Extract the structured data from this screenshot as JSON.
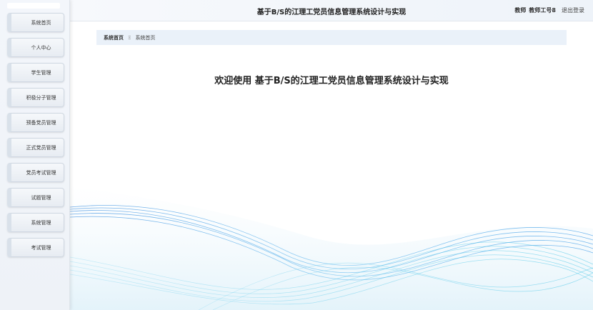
{
  "header": {
    "title": "基于B/S的江理工党员信息管理系统设计与实现",
    "role": "教师",
    "user": "教师工号8",
    "logout": "退出登录"
  },
  "sidebar": {
    "items": [
      {
        "label": "系统首页"
      },
      {
        "label": "个人中心"
      },
      {
        "label": "学生管理"
      },
      {
        "label": "积极分子管理"
      },
      {
        "label": "预备党员管理"
      },
      {
        "label": "正式党员管理"
      },
      {
        "label": "党员考试管理"
      },
      {
        "label": "试题管理"
      },
      {
        "label": "系统管理"
      },
      {
        "label": "考试管理"
      }
    ]
  },
  "breadcrumb": {
    "home": "系统首页",
    "separator": "Ξ",
    "current": "系统首页"
  },
  "main": {
    "welcome": "欢迎使用 基于B/S的江理工党员信息管理系统设计与实现"
  },
  "colors": {
    "accent_wave": "#4aa8e6",
    "wave_light": "#8fd6ee",
    "breadcrumb_bg": "#eaf1f9"
  }
}
